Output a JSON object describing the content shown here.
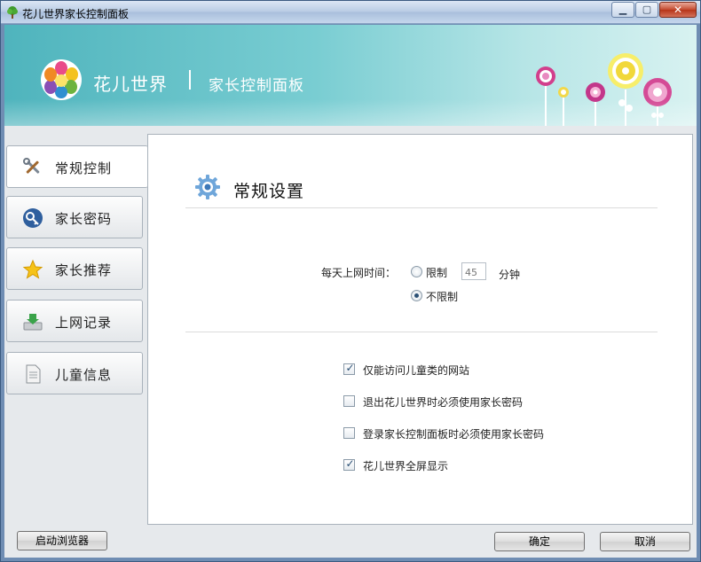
{
  "window": {
    "title": "花儿世界家长控制面板"
  },
  "banner": {
    "brand": "花儿世界",
    "separator": "|",
    "subtitle": "家长控制面板"
  },
  "sidebar": {
    "items": [
      {
        "label": "常规控制",
        "icon": "tools-icon",
        "active": true
      },
      {
        "label": "家长密码",
        "icon": "key-icon",
        "active": false
      },
      {
        "label": "家长推荐",
        "icon": "star-icon",
        "active": false
      },
      {
        "label": "上网记录",
        "icon": "download-record-icon",
        "active": false
      },
      {
        "label": "儿童信息",
        "icon": "document-icon",
        "active": false
      }
    ]
  },
  "main": {
    "section_title": "常规设置",
    "time_label": "每天上网时间：",
    "radio_limit": "限制",
    "minutes_placeholder": "45",
    "minutes_unit": "分钟",
    "radio_unlimited": "不限制",
    "selected_radio": "不限制",
    "options": [
      {
        "label": "仅能访问儿童类的网站",
        "checked": true
      },
      {
        "label": "退出花儿世界时必须使用家长密码",
        "checked": false
      },
      {
        "label": "登录家长控制面板时必须使用家长密码",
        "checked": false
      },
      {
        "label": "花儿世界全屏显示",
        "checked": true
      }
    ]
  },
  "footer": {
    "browser_button": "启动浏览器",
    "ok_button": "确定",
    "cancel_button": "取消"
  },
  "colors": {
    "banner": "#5cbfc6",
    "accent": "#2a4f74"
  }
}
